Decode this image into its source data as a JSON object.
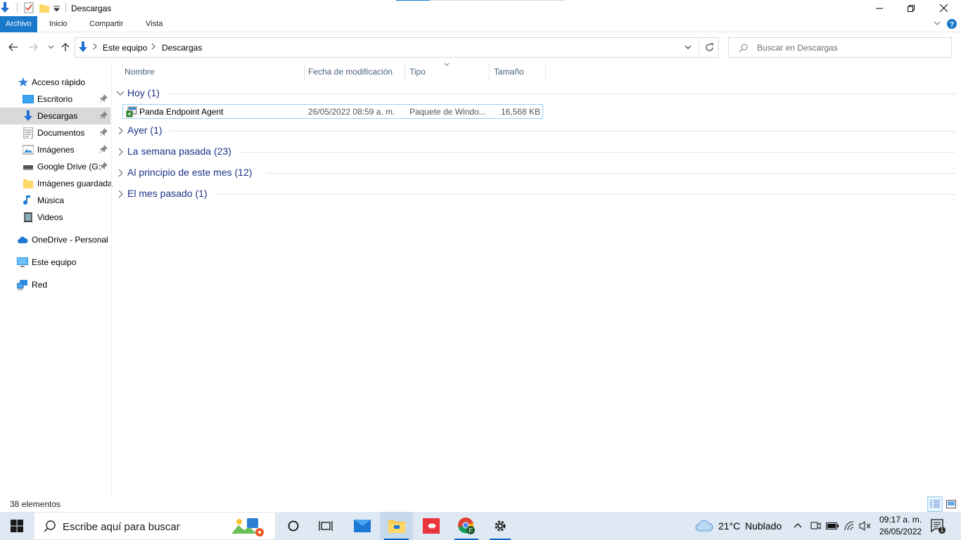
{
  "window": {
    "title": "Descargas"
  },
  "ribbon": {
    "tabs": [
      "Archivo",
      "Inicio",
      "Compartir",
      "Vista"
    ]
  },
  "address": {
    "segments": [
      "Este equipo",
      "Descargas"
    ]
  },
  "search": {
    "placeholder": "Buscar en Descargas"
  },
  "sidebar": {
    "items": [
      {
        "label": "Acceso rápido",
        "icon": "star-icon"
      },
      {
        "label": "Escritorio",
        "icon": "desktop-icon",
        "pinned": true
      },
      {
        "label": "Descargas",
        "icon": "download-icon",
        "pinned": true,
        "selected": true
      },
      {
        "label": "Documentos",
        "icon": "documents-icon",
        "pinned": true
      },
      {
        "label": "Imágenes",
        "icon": "pictures-icon",
        "pinned": true
      },
      {
        "label": "Google Drive (G:",
        "icon": "drive-icon",
        "pinned": true
      },
      {
        "label": "Imágenes guardada",
        "icon": "folder-icon"
      },
      {
        "label": "Música",
        "icon": "music-icon"
      },
      {
        "label": "Videos",
        "icon": "video-icon"
      },
      {
        "label": "OneDrive - Personal",
        "icon": "cloud-icon"
      },
      {
        "label": "Este equipo",
        "icon": "computer-icon"
      },
      {
        "label": "Red",
        "icon": "network-icon"
      }
    ]
  },
  "columns": {
    "name": "Nombre",
    "modified": "Fecha de modificación",
    "type": "Tipo",
    "size": "Tamaño"
  },
  "groups": [
    {
      "label": "Hoy (1)",
      "expanded": true
    },
    {
      "label": "Ayer (1)",
      "expanded": false
    },
    {
      "label": "La semana pasada (23)",
      "expanded": false
    },
    {
      "label": "Al principio de este mes (12)",
      "expanded": false
    },
    {
      "label": "El mes pasado (1)",
      "expanded": false
    }
  ],
  "files": [
    {
      "name": "Panda Endpoint Agent",
      "modified": "26/05/2022 08:59 a. m.",
      "type": "Paquete de Windo...",
      "size": "16,568 KB"
    }
  ],
  "status": {
    "count": "38 elementos"
  },
  "taskbar": {
    "search_placeholder": "Escribe aquí para buscar",
    "weather_temp": "21°C",
    "weather_desc": "Nublado",
    "time": "09:17 a. m.",
    "date": "26/05/2022",
    "notifications": "1"
  },
  "colors": {
    "accent": "#1979ca",
    "group_text": "#1e3287",
    "selection_border": "#99d1ff",
    "taskbar_bg": "#dfe9f4"
  }
}
